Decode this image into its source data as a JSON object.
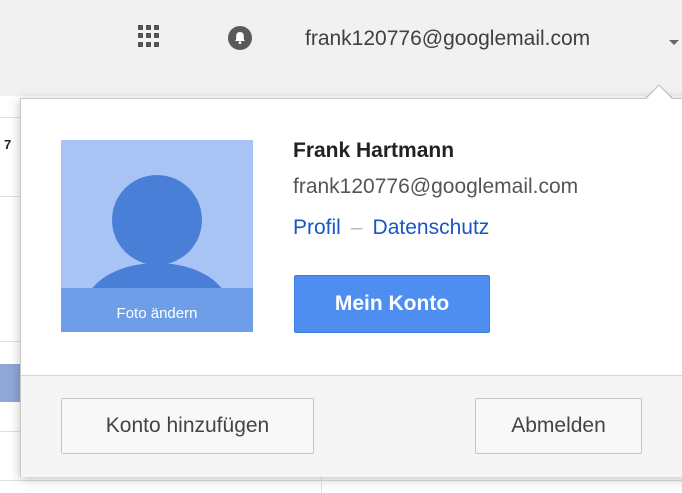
{
  "topbar": {
    "apps_icon": "apps-grid-icon",
    "notifications_icon": "notifications-icon",
    "account_email": "frank120776@googlemail.com",
    "caret_icon": "chevron-down-icon"
  },
  "background": {
    "partial_number": "7"
  },
  "popup": {
    "photo": {
      "icon": "avatar-placeholder-icon",
      "caption": "Foto ändern"
    },
    "user": {
      "name": "Frank Hartmann",
      "email": "frank120776@googlemail.com"
    },
    "links": {
      "profile": "Profil",
      "separator": "–",
      "privacy": "Datenschutz"
    },
    "primary_button": "Mein Konto",
    "footer": {
      "add_account": "Konto hinzufügen",
      "sign_out": "Abmelden"
    }
  },
  "colors": {
    "primary_button": "#4d8ef0",
    "link": "#1a56c4",
    "photo_bg": "#a8c4f5"
  }
}
